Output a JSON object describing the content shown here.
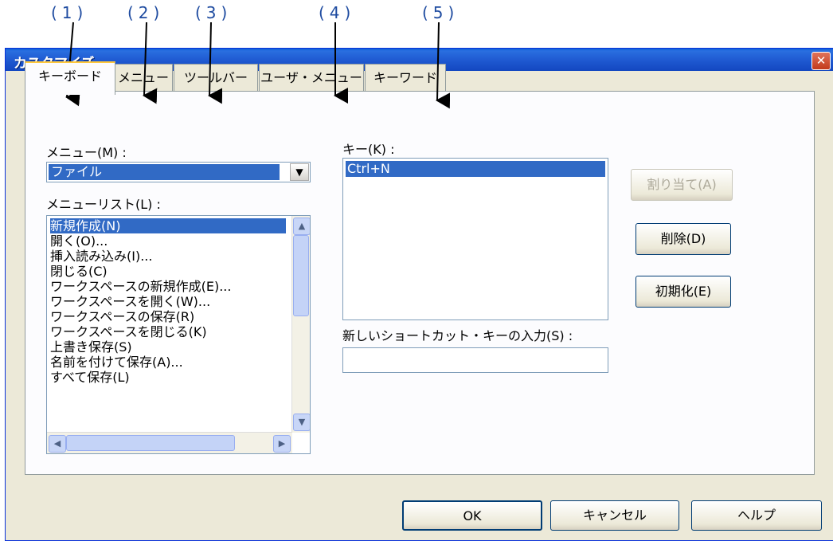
{
  "annotations": [
    "(1)",
    "(2)",
    "(3)",
    "(4)",
    "(5)"
  ],
  "window": {
    "title": "カスタマイズ",
    "close_label": "✕"
  },
  "tabs": [
    {
      "label": "キーボード",
      "active": true
    },
    {
      "label": "メニュー",
      "active": false
    },
    {
      "label": "ツールバー",
      "active": false
    },
    {
      "label": "ユーザ・メニュー",
      "active": false
    },
    {
      "label": "キーワード",
      "active": false
    }
  ],
  "menu": {
    "label": "メニュー(M) :",
    "value": "ファイル"
  },
  "menu_list": {
    "label": "メニューリスト(L) :",
    "items": [
      "新規作成(N)",
      "開く(O)...",
      "挿入読み込み(I)...",
      "閉じる(C)",
      "ワークスペースの新規作成(E)...",
      "ワークスペースを開く(W)...",
      "ワークスペースの保存(R)",
      "ワークスペースを閉じる(K)",
      "上書き保存(S)",
      "名前を付けて保存(A)...",
      "すべて保存(L)"
    ],
    "selected_index": 0
  },
  "key": {
    "label": "キー(K) :",
    "items": [
      "Ctrl+N"
    ]
  },
  "new_shortcut": {
    "label": "新しいショートカット・キーの入力(S) :",
    "value": ""
  },
  "buttons": {
    "assign": "割り当て(A)",
    "delete": "削除(D)",
    "reset": "初期化(E)",
    "ok": "OK",
    "cancel": "キャンセル",
    "help": "ヘルプ"
  },
  "colors": {
    "selection": "#316ac5",
    "titlebar": "#1e58d0",
    "annotation": "#1e4ba0"
  }
}
